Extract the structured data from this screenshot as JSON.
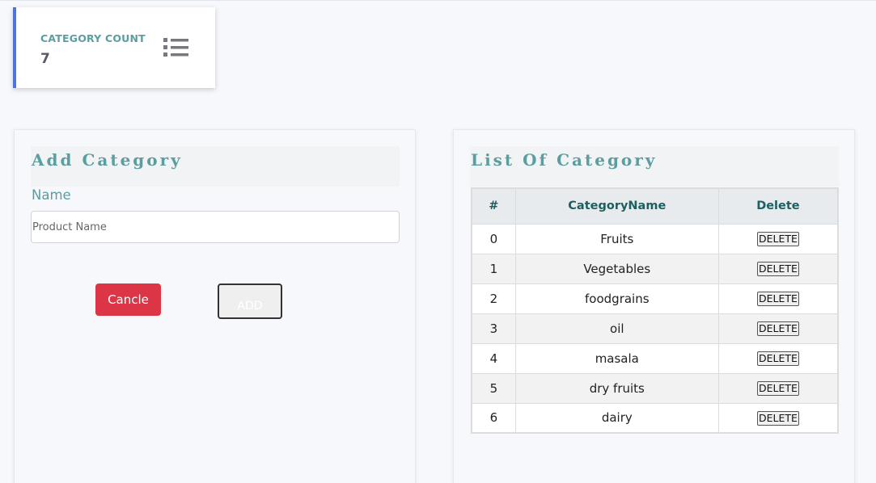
{
  "stat_card": {
    "label": "CATEGORY COUNT",
    "value": "7",
    "icon": "list-icon"
  },
  "add_panel": {
    "title": "Add Category",
    "name_label": "Name",
    "input_placeholder": "Product Name",
    "input_value": "",
    "cancel_label": "Cancle",
    "add_label": "ADD"
  },
  "list_panel": {
    "title": "List Of Category",
    "columns": [
      "#",
      "CategoryName",
      "Delete"
    ],
    "rows": [
      {
        "index": "0",
        "name": "Fruits",
        "action": "DELETE"
      },
      {
        "index": "1",
        "name": "Vegetables",
        "action": "DELETE"
      },
      {
        "index": "2",
        "name": "foodgrains",
        "action": "DELETE"
      },
      {
        "index": "3",
        "name": "oil",
        "action": "DELETE"
      },
      {
        "index": "4",
        "name": "masala",
        "action": "DELETE"
      },
      {
        "index": "5",
        "name": "dry fruits",
        "action": "DELETE"
      },
      {
        "index": "6",
        "name": "dairy",
        "action": "DELETE"
      }
    ]
  },
  "colors": {
    "accent": "#4e73df",
    "heading": "#5a9ea0",
    "danger": "#dc3545",
    "table_header_text": "#1f5e5e"
  }
}
